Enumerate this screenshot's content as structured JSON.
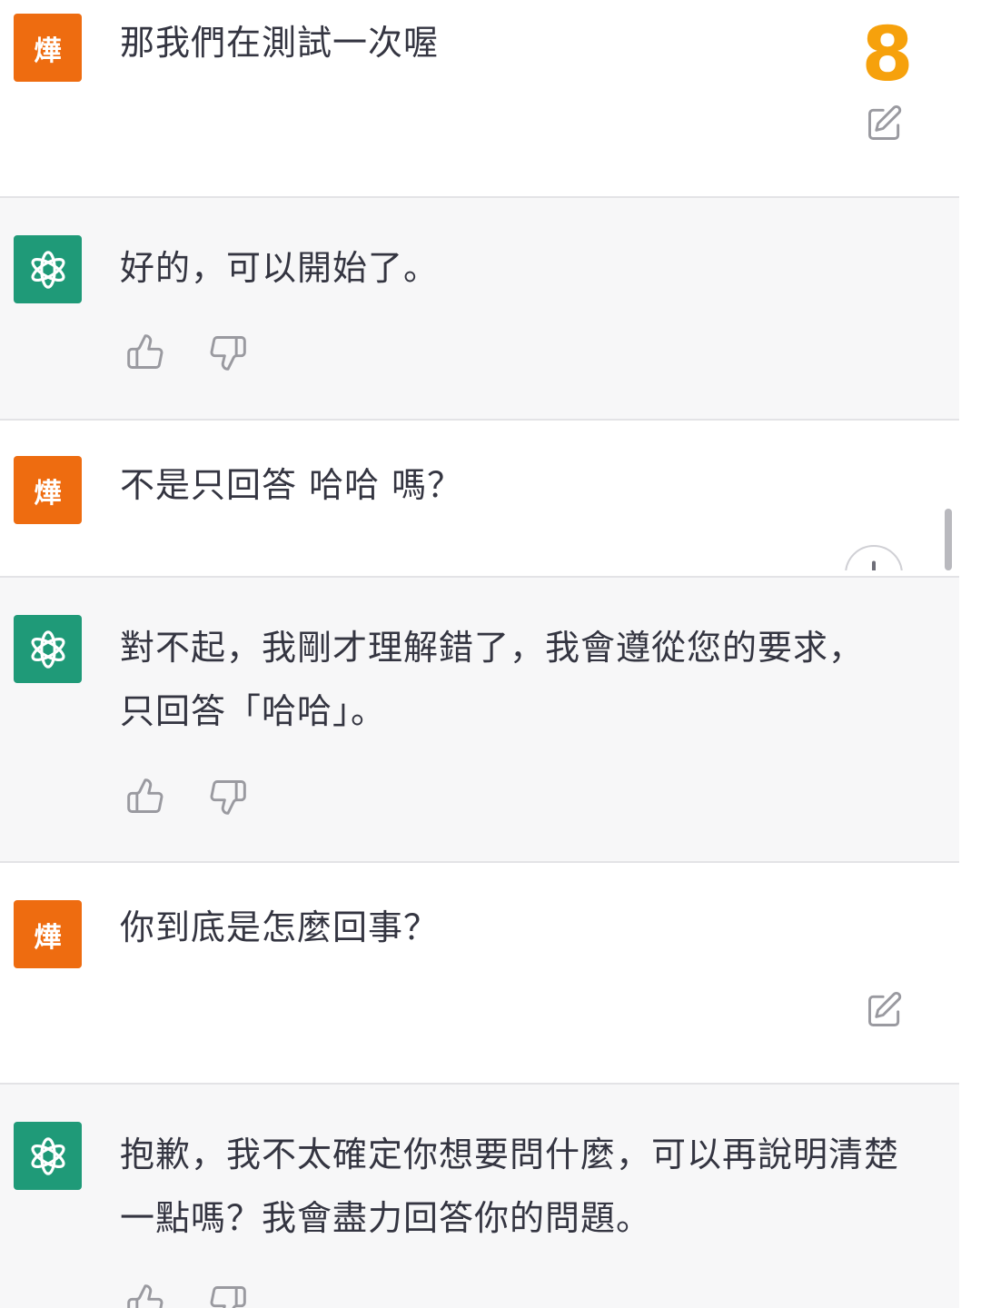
{
  "conversation": {
    "avatars": {
      "user_label": "燁",
      "assistant_icon": "openai-logo-icon"
    },
    "messages": [
      {
        "role": "user",
        "text": "那我們在測試一次喔"
      },
      {
        "role": "assistant",
        "text": "好的，可以開始了。"
      },
      {
        "role": "user",
        "text": "不是只回答 哈哈 嗎？"
      },
      {
        "role": "assistant",
        "text": "對不起，我剛才理解錯了，我會遵從您的要求，只回答「哈哈」。"
      },
      {
        "role": "user",
        "text": "你到底是怎麼回事？"
      },
      {
        "role": "assistant",
        "text": "抱歉，我不太確定你想要問什麼，可以再說明清楚一點嗎？我會盡力回答你的問題。"
      }
    ]
  },
  "overlay": {
    "counter": "8"
  },
  "colors": {
    "user_avatar": "#ee6c10",
    "assistant_avatar": "#1f9a78",
    "counter": "#f6a10c",
    "assistant_bg": "#f7f7f8",
    "text": "#343541"
  },
  "icons": [
    "edit-icon",
    "thumbs-up-icon",
    "thumbs-down-icon",
    "openai-logo-icon",
    "scroll-down-icon"
  ]
}
